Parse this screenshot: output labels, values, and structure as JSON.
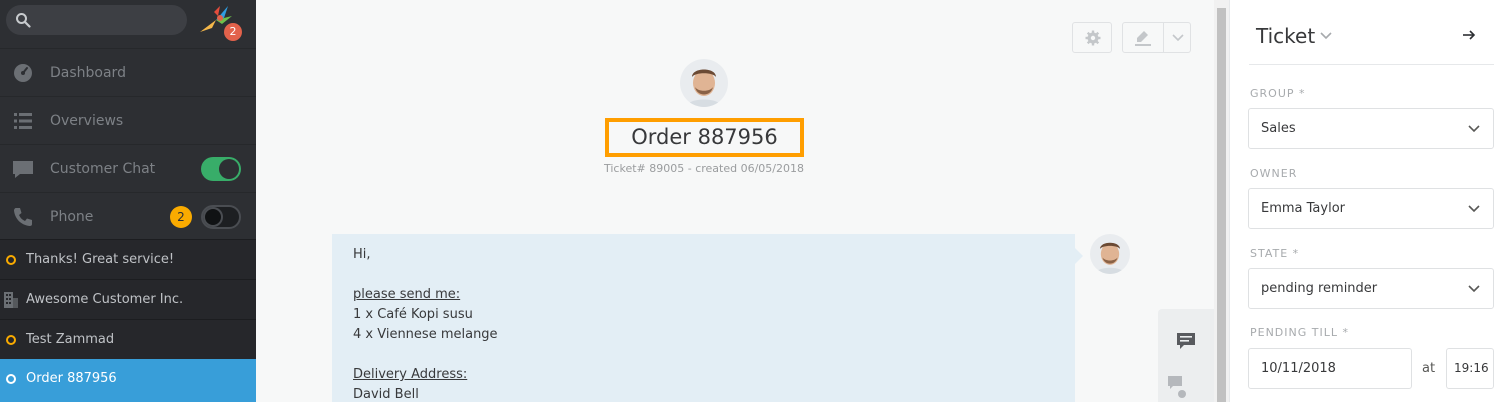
{
  "sidebar": {
    "search": {
      "placeholder": ""
    },
    "logo_badge": "2",
    "nav": [
      {
        "label": "Dashboard",
        "icon": "dashboard-icon"
      },
      {
        "label": "Overviews",
        "icon": "list-icon"
      },
      {
        "label": "Customer Chat",
        "icon": "chat-icon",
        "toggle": "on"
      },
      {
        "label": "Phone",
        "icon": "phone-icon",
        "badge": "2",
        "toggle": "off"
      }
    ],
    "tasks": [
      {
        "label": "Thanks! Great service!",
        "icon": "ticket-ring-icon"
      },
      {
        "label": "Awesome Customer Inc.",
        "icon": "organization-icon"
      },
      {
        "label": "Test Zammad",
        "icon": "ticket-ring-icon"
      },
      {
        "label": "Order 887956",
        "icon": "ticket-ring-icon",
        "active": true
      }
    ]
  },
  "ticket": {
    "title": "Order 887956",
    "meta": "Ticket# 89005 - created 06/05/2018",
    "article": {
      "greeting": "Hi,",
      "request_heading": "please send me:",
      "line1": "1 x Café Kopi susu",
      "line2": "4 x Viennese melange",
      "address_heading": "Delivery Address:",
      "address_name": "David Bell"
    }
  },
  "panel": {
    "title": "Ticket",
    "group_label": "GROUP *",
    "group_value": "Sales",
    "owner_label": "OWNER",
    "owner_value": "Emma Taylor",
    "state_label": "STATE *",
    "state_value": "pending reminder",
    "pending_label": "PENDING TILL *",
    "pending_date": "10/11/2018",
    "at_label": "at",
    "pending_time": "19:16"
  },
  "colors": {
    "sidebar_bg": "#2d2f33",
    "active_task": "#389ed9",
    "toggle_on": "#38ad69",
    "badge": "#faab00",
    "highlight": "#ff9e00",
    "article_bg": "#e3eef5"
  }
}
